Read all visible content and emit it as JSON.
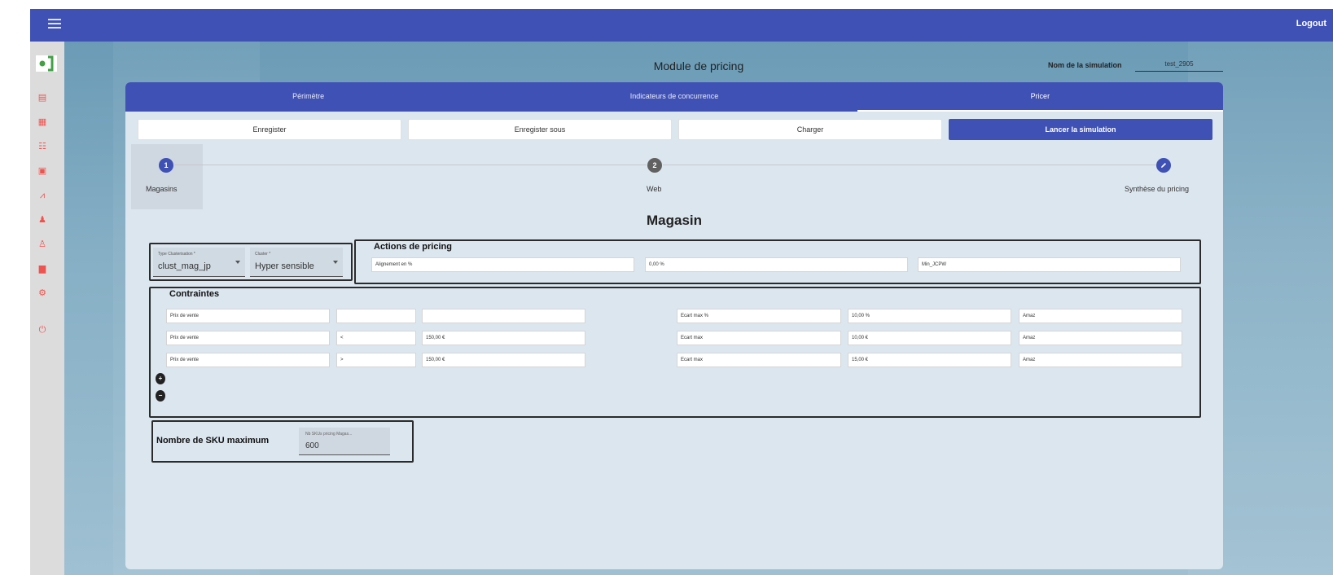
{
  "topbar": {
    "logout_label": "Logout"
  },
  "sidebar": {
    "items": [
      {
        "icon": "list-icon",
        "glyph": "▤"
      },
      {
        "icon": "dashboard-icon",
        "glyph": "▦"
      },
      {
        "icon": "table-icon",
        "glyph": "☷"
      },
      {
        "icon": "calculator-icon",
        "glyph": "▣"
      },
      {
        "icon": "chart-icon",
        "glyph": "⩘"
      },
      {
        "icon": "users-icon",
        "glyph": "♟"
      },
      {
        "icon": "user-upload-icon",
        "glyph": "♙"
      },
      {
        "icon": "document-icon",
        "glyph": "▆"
      },
      {
        "icon": "settings-icon",
        "glyph": "⚙"
      },
      {
        "icon": "power-icon",
        "glyph": "⏻"
      }
    ],
    "accent": "#ef5350"
  },
  "page": {
    "title": "Module de pricing",
    "simulation_label": "Nom de la simulation",
    "simulation_value": "test_2905"
  },
  "tabs": [
    {
      "label": "Périmètre",
      "active": false
    },
    {
      "label": "Indicateurs de concurrence",
      "active": false
    },
    {
      "label": "Pricer",
      "active": true
    }
  ],
  "actions": {
    "save": "Enregister",
    "save_as": "Enregister sous",
    "load": "Charger",
    "run": "Lancer la simulation"
  },
  "stepper": {
    "steps": [
      {
        "number": "1",
        "label": "Magasins",
        "state": "active"
      },
      {
        "number": "2",
        "label": "Web",
        "state": "inactive"
      },
      {
        "number": "",
        "label": "Synthèse du pricing",
        "state": "edit"
      }
    ]
  },
  "section": {
    "title": "Magasin"
  },
  "cluster": {
    "type_label": "Type Clusterisation *",
    "type_value": "clust_mag_jp",
    "cluster_label": "Cluster *",
    "cluster_value": "Hyper sensible"
  },
  "pricing_actions": {
    "title": "Actions de pricing",
    "fields": [
      "Alignement en %",
      "0,00 %",
      "Min_JCPW"
    ]
  },
  "constraints": {
    "title": "Contraintes",
    "rows": [
      [
        "Prix de vente",
        "",
        "",
        "Ecart max %",
        "10,00 %",
        "Amaz"
      ],
      [
        "Prix de vente",
        "<",
        "150,00 €",
        "Ecart max",
        "10,00 €",
        "Amaz"
      ],
      [
        "Prix de vente",
        ">",
        "150,00 €",
        "Ecart max",
        "15,00 €",
        "Amaz"
      ]
    ],
    "add_label": "+",
    "remove_label": "−"
  },
  "sku": {
    "title": "Nombre de SKU maximum",
    "field_label": "Nb SKUs pricing Magas...",
    "field_value": "600"
  },
  "colors": {
    "primary": "#3f51b5",
    "card_background": "#dce6ef",
    "step_inactive": "#616161"
  }
}
